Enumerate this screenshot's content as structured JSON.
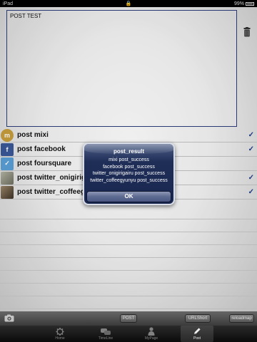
{
  "status_bar": {
    "carrier": "iPad",
    "time": "",
    "battery": "99%"
  },
  "editor": {
    "text": "POST TEST"
  },
  "services": [
    {
      "label": "post mixi",
      "icon": "mixi-icon",
      "color": "#c79d3c",
      "checked": true
    },
    {
      "label": "post facebook",
      "icon": "facebook-icon",
      "color": "#3b5998",
      "checked": true
    },
    {
      "label": "post foursquare",
      "icon": "foursquare-icon",
      "color": "#5aa0d6",
      "checked": false
    },
    {
      "label": "post twitter_onigirigairu",
      "icon": "twitter-avatar-icon",
      "color": "#8a8a7a",
      "checked": true
    },
    {
      "label": "post twitter_coffeegyunyu",
      "icon": "twitter-avatar-icon",
      "color": "#5b4a3a",
      "checked": true
    }
  ],
  "toolbar": {
    "post_label": "POST",
    "urlshort_label": "URLShort",
    "reload_label": "reloadmap"
  },
  "tabs": [
    {
      "label": "Home",
      "active": false
    },
    {
      "label": "TimeLine",
      "active": false
    },
    {
      "label": "MyPage",
      "active": false
    },
    {
      "label": "Post",
      "active": true
    }
  ],
  "alert": {
    "title": "post_result",
    "lines": [
      "mixi post_success",
      "facebook post_success",
      "twitter_onigirigairu post_success",
      "twitter_coffeegyunyu post_success"
    ],
    "ok_label": "OK"
  }
}
